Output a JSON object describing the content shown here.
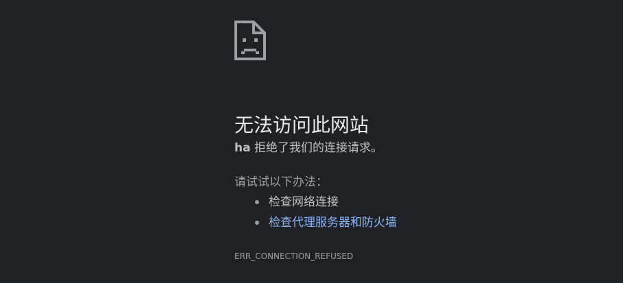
{
  "page": {
    "icon": "sad-document-icon",
    "title": "无法访问此网站",
    "host": "ha",
    "message_suffix": " 拒绝了我们的连接请求。",
    "try_label": "请试试以下办法：",
    "suggestions": [
      {
        "text": "检查网络连接",
        "is_link": false
      },
      {
        "text": "检查代理服务器和防火墙",
        "is_link": true
      }
    ],
    "error_code": "ERR_CONNECTION_REFUSED"
  },
  "colors": {
    "background": "#202124",
    "title": "#e8eaed",
    "text": "#bdc1c6",
    "muted": "#9aa0a6",
    "link": "#8ab4f8"
  }
}
